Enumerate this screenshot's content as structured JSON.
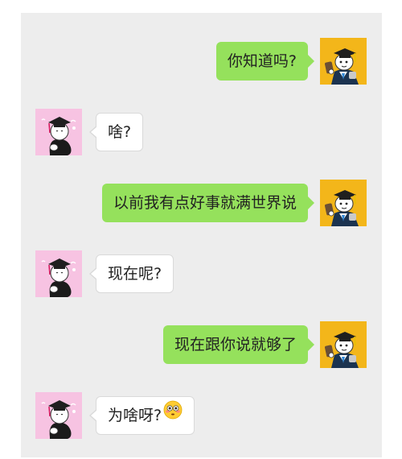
{
  "colors": {
    "sent_bubble": "#95e15c",
    "received_bubble": "#ffffff",
    "chat_background": "#ededed",
    "sender_avatar_bg": "#f3b61a",
    "receiver_avatar_bg": "#f7c3e2"
  },
  "messages": [
    {
      "side": "right",
      "text": "你知道吗?",
      "avatar_icon": "graduate-with-phone-avatar-icon"
    },
    {
      "side": "left",
      "text": "啥?",
      "avatar_icon": "graduate-on-pink-avatar-icon"
    },
    {
      "side": "right",
      "text": "以前我有点好事就满世界说",
      "avatar_icon": "graduate-with-phone-avatar-icon"
    },
    {
      "side": "left",
      "text": "现在呢?",
      "avatar_icon": "graduate-on-pink-avatar-icon"
    },
    {
      "side": "right",
      "text": "现在跟你说就够了",
      "avatar_icon": "graduate-with-phone-avatar-icon"
    },
    {
      "side": "left",
      "text": "为啥呀?",
      "emoji": "flushed-face-icon",
      "avatar_icon": "graduate-on-pink-avatar-icon"
    }
  ]
}
